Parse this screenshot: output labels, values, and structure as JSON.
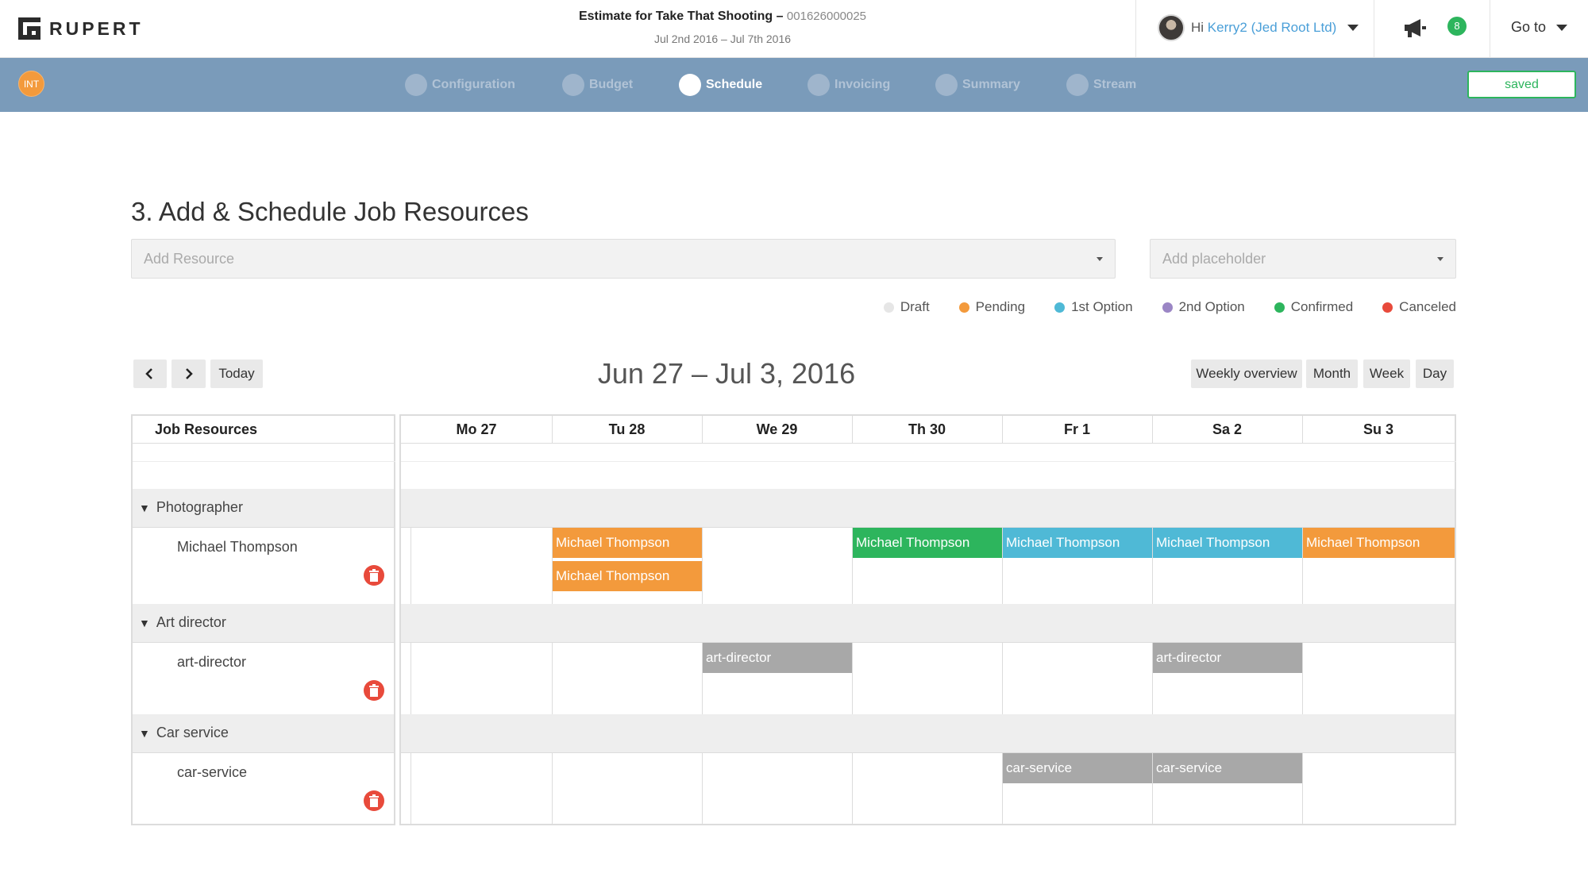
{
  "header": {
    "logo_text": "RUPERT",
    "title_prefix": "Estimate for Take That Shooting –",
    "job_number": "001626000025",
    "dates": "Jul 2nd 2016 – Jul 7th 2016",
    "greeting": "Hi",
    "user_name": "Kerry2 (Jed Root Ltd)",
    "notification_count": "8",
    "goto_label": "Go to"
  },
  "stepbar": {
    "badge": "INT",
    "steps": [
      {
        "label": "Configuration",
        "active": false
      },
      {
        "label": "Budget",
        "active": false
      },
      {
        "label": "Schedule",
        "active": true
      },
      {
        "label": "Invoicing",
        "active": false
      },
      {
        "label": "Summary",
        "active": false
      },
      {
        "label": "Stream",
        "active": false
      }
    ],
    "saved_label": "saved"
  },
  "main": {
    "section_title": "3. Add & Schedule Job Resources",
    "add_resource_placeholder": "Add Resource",
    "add_placeholder_placeholder": "Add placeholder"
  },
  "legend": [
    {
      "label": "Draft",
      "color": "#e6e6e6"
    },
    {
      "label": "Pending",
      "color": "#f39a3c"
    },
    {
      "label": "1st Option",
      "color": "#4fb9d6"
    },
    {
      "label": "2nd Option",
      "color": "#9b86c5"
    },
    {
      "label": "Confirmed",
      "color": "#2db55d"
    },
    {
      "label": "Canceled",
      "color": "#e84a3b"
    }
  ],
  "calendar": {
    "prev_label": "<",
    "next_label": ">",
    "today_label": "Today",
    "range_title": "Jun 27 – Jul 3, 2016",
    "views": [
      "Weekly overview",
      "Month",
      "Week",
      "Day"
    ],
    "resources_header": "Job Resources",
    "days": [
      "Mo 27",
      "Tu 28",
      "We 29",
      "Th 30",
      "Fr 1",
      "Sa 2",
      "Su 3"
    ],
    "groups": [
      {
        "name": "Photographer",
        "resource": "Michael Thompson"
      },
      {
        "name": "Art director",
        "resource": "art-director"
      },
      {
        "name": "Car service",
        "resource": "car-service"
      }
    ],
    "events": [
      {
        "label": "Michael Thompson",
        "status": "Pending"
      },
      {
        "label": "Michael Thompson",
        "status": "Pending"
      },
      {
        "label": "Michael Thompson",
        "status": "Confirmed"
      },
      {
        "label": "Michael Thompson",
        "status": "1st Option"
      },
      {
        "label": "Michael Thompson",
        "status": "1st Option"
      },
      {
        "label": "Michael Thompson",
        "status": "Pending"
      },
      {
        "label": "art-director",
        "status": "Draft"
      },
      {
        "label": "art-director",
        "status": "Draft"
      },
      {
        "label": "car-service",
        "status": "Draft"
      },
      {
        "label": "car-service",
        "status": "Draft"
      }
    ]
  },
  "colors": {
    "accent_blue": "#7a9bba",
    "link": "#4a9fd8",
    "confirmed": "#2db55d",
    "pending": "#f39a3c",
    "first_option": "#4fb9d6",
    "draft_block": "#a8a8a8",
    "delete": "#e84a3b"
  }
}
